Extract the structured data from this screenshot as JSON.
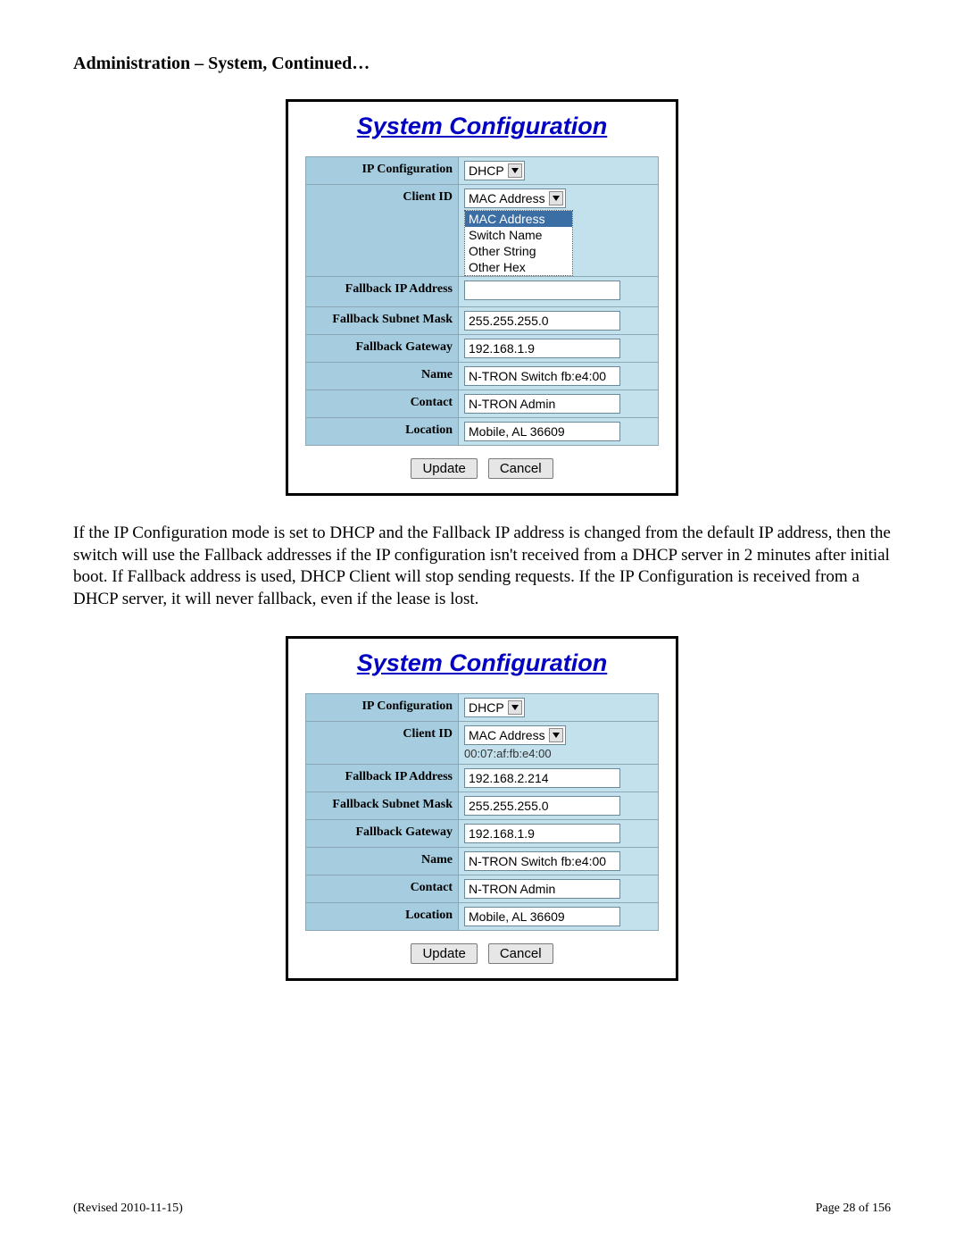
{
  "heading": "Administration – System, Continued…",
  "panel1": {
    "title": "System Configuration",
    "rows": {
      "ip_config": {
        "label": "IP Configuration",
        "value": "DHCP"
      },
      "client_id": {
        "label": "Client ID",
        "value": "MAC Address",
        "options": [
          "MAC Address",
          "Switch Name",
          "Other String",
          "Other Hex"
        ],
        "selected": "MAC Address"
      },
      "fallback_ip": {
        "label": "Fallback IP Address",
        "value": ""
      },
      "fallback_mask": {
        "label": "Fallback Subnet Mask",
        "value": "255.255.255.0"
      },
      "fallback_gw": {
        "label": "Fallback Gateway",
        "value": "192.168.1.9"
      },
      "name": {
        "label": "Name",
        "value": "N-TRON Switch fb:e4:00"
      },
      "contact": {
        "label": "Contact",
        "value": "N-TRON Admin"
      },
      "location": {
        "label": "Location",
        "value": "Mobile, AL  36609"
      }
    },
    "buttons": {
      "update": "Update",
      "cancel": "Cancel"
    }
  },
  "body_text": "If the IP Configuration mode is set to DHCP and the Fallback IP address is changed from the default IP address, then the switch will use the Fallback addresses if the IP configuration isn't received from a DHCP server in 2 minutes after initial boot.  If Fallback address is used, DHCP Client will stop sending requests. If the IP Configuration is received from a DHCP server, it will never fallback, even if the lease is lost.",
  "panel2": {
    "title": "System Configuration",
    "rows": {
      "ip_config": {
        "label": "IP Configuration",
        "value": "DHCP"
      },
      "client_id": {
        "label": "Client ID",
        "value": "MAC Address",
        "subtext": "00:07:af:fb:e4:00"
      },
      "fallback_ip": {
        "label": "Fallback IP Address",
        "value": "192.168.2.214"
      },
      "fallback_mask": {
        "label": "Fallback Subnet Mask",
        "value": "255.255.255.0"
      },
      "fallback_gw": {
        "label": "Fallback Gateway",
        "value": "192.168.1.9"
      },
      "name": {
        "label": "Name",
        "value": "N-TRON Switch fb:e4:00"
      },
      "contact": {
        "label": "Contact",
        "value": "N-TRON Admin"
      },
      "location": {
        "label": "Location",
        "value": "Mobile, AL  36609"
      }
    },
    "buttons": {
      "update": "Update",
      "cancel": "Cancel"
    }
  },
  "footer": {
    "revised": "(Revised 2010-11-15)",
    "page": "Page 28 of 156"
  }
}
